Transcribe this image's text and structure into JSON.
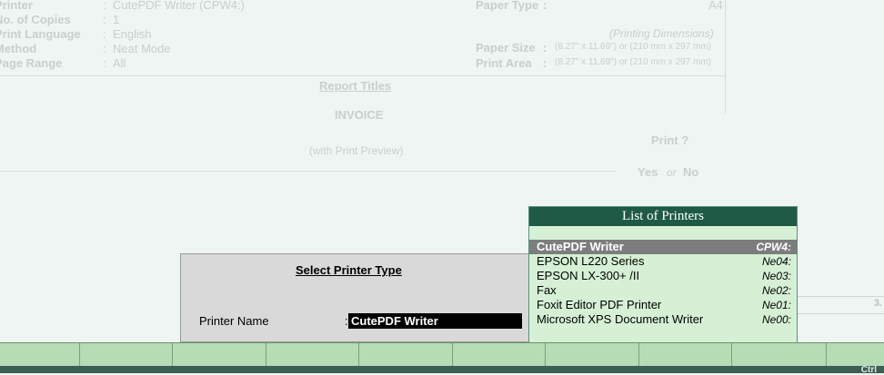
{
  "print_config": {
    "fields": [
      {
        "label": "Printer",
        "value": "CutePDF Writer (CPW4:)"
      },
      {
        "label": "No. of Copies",
        "value": "1"
      },
      {
        "label": "Print Language",
        "value": "English"
      },
      {
        "label": "Method",
        "value": "Neat Mode"
      },
      {
        "label": "Page Range",
        "value": "All"
      }
    ],
    "paper_type_label": "Paper Type",
    "paper_type_value": "A4",
    "printing_dimensions": "(Printing Dimensions)",
    "paper_size_label": "Paper Size",
    "paper_size_value": "(8.27\" x 11.69\") or (210 mm x 297 mm)",
    "print_area_label": "Print Area",
    "print_area_value": "(8.27\" x 11.69\") or (210 mm x 297 mm)",
    "colon": ":"
  },
  "report": {
    "titles_heading": "Report Titles",
    "title": "INVOICE",
    "subtitle": "(with Print Preview)"
  },
  "print_prompt": {
    "question": "Print ?",
    "yes": "Yes",
    "or": "or",
    "no": "No"
  },
  "select_printer_dialog": {
    "title": "Select Printer Type",
    "printer_name_label": "Printer Name",
    "colon": ":",
    "printer_name_value": "CutePDF Writer"
  },
  "printer_list": {
    "title": "List of Printers",
    "items": [
      {
        "name": "CutePDF Writer",
        "code": "CPW4:"
      },
      {
        "name": "EPSON L220 Series",
        "code": "Ne04:"
      },
      {
        "name": "EPSON LX-300+ /II",
        "code": "Ne03:"
      },
      {
        "name": "Fax",
        "code": "Ne02:"
      },
      {
        "name": "Foxit Editor PDF Printer",
        "code": "Ne01:"
      },
      {
        "name": "Microsoft XPS Document Writer",
        "code": "Ne00:"
      }
    ],
    "selected_index": 0
  },
  "right_fragment_text": "3.",
  "status_bar": {
    "ctrl_label": "Ctrl"
  },
  "colors": {
    "list_header": "#1e5a45",
    "list_background": "#d5f0d5",
    "selected_row": "#7d7d7d",
    "function_bar": "#b6dcb6",
    "status_bar": "#3d5e55"
  }
}
